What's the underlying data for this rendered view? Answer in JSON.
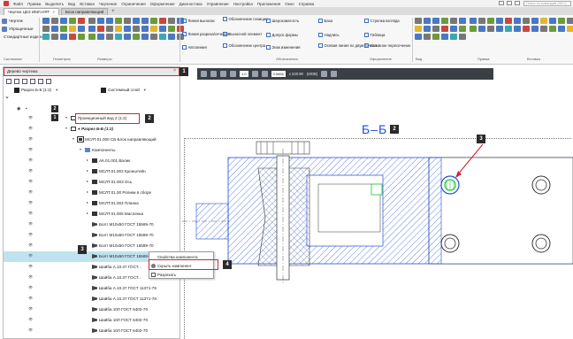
{
  "menu": [
    "Файл",
    "Правка",
    "Выделить",
    "Вид",
    "Вставка",
    "Черчение",
    "Ограничения",
    "Оформление",
    "Диагностика",
    "Управление",
    "Настройка",
    "Приложения",
    "Окно",
    "Справка"
  ],
  "search_placeholder": "Поиск по командам (Alt+/)",
  "tabs": [
    {
      "label": "Чертеж ЦЕЗ ИМЛ.НЯТ",
      "active": true
    },
    {
      "label": "Блок направляющий",
      "active": false
    }
  ],
  "ribbon": {
    "left_items": [
      "Чертеж",
      "Упрощенные",
      "Стандартные изделия"
    ],
    "commands": [
      "Линия выноски",
      "Обозначение позиции",
      "Шероховатость",
      "База",
      "Стрелка взгляда",
      "Линия разреза/сечения",
      "Выносной элемент",
      "Допуск формы",
      "Надпись",
      "Таблица",
      "Автолиния",
      "Обозначение центра",
      "Знак изменения",
      "Осевая линия по двум точкам",
      "Условное пересечение"
    ],
    "groups": [
      "Системная",
      "Геометрия",
      "Размеры",
      "Обозначения",
      "Оформление",
      "Вид",
      "Правка",
      "Вставка"
    ]
  },
  "drawing_toolbar": {
    "step_value": "1.0",
    "zoom_value": "0.9666",
    "coords": "х 220.90",
    "fragment_value": "(МОВ)"
  },
  "panel": {
    "title": "Дерево чертежа",
    "view_selector": "Разрез Б-Б (1:2)",
    "layer_selector": "Системный слой",
    "filter_icon": "filter-icon"
  },
  "tree": {
    "rows": [
      {
        "label": "Проекционный вид 2 (1:2)",
        "type": "view"
      },
      {
        "label": "● Разрез Б-Б (1:2)",
        "type": "view"
      },
      {
        "label": "МСЛТ.01.000 СБ Блок направляющий",
        "type": "asm"
      },
      {
        "label": "Компоненты",
        "type": "folder"
      },
      {
        "label": "АК.01.001 Валик",
        "type": "part"
      },
      {
        "label": "МСЛТ.01.002 Кронштейн",
        "type": "part"
      },
      {
        "label": "МСЛТ.01.003 Ось",
        "type": "part"
      },
      {
        "label": "МСЛТ.01.00 Ролики в сборе",
        "type": "part"
      },
      {
        "label": "МСЛТ.01.004 Планка",
        "type": "part"
      },
      {
        "label": "МСЛТ.01.005 Масленка",
        "type": "part"
      },
      {
        "label": "Болт М10х50 ГОСТ 15589-70",
        "type": "bolt"
      },
      {
        "label": "Болт М10х50 ГОСТ 15589-70",
        "type": "bolt"
      },
      {
        "label": "Болт М10х50 ГОСТ 15589-70",
        "type": "bolt"
      },
      {
        "label": "Болт М10х50 ГОСТ 15589-70",
        "type": "bolt"
      },
      {
        "label": "Шайба А.10.37 ГОСТ...",
        "type": "bolt"
      },
      {
        "label": "Шайба А.10.37 ГОСТ...",
        "type": "bolt"
      },
      {
        "label": "Шайба А.10.37 ГОСТ 11371-78",
        "type": "bolt"
      },
      {
        "label": "Шайба А.10.37 ГОСТ 11371-78",
        "type": "bolt"
      },
      {
        "label": "Шайба 10Л ГОСТ 6402-70",
        "type": "bolt"
      },
      {
        "label": "Шайба 10Л ГОСТ 6402-70",
        "type": "bolt"
      },
      {
        "label": "Шайба 10Л ГОСТ 6402-70",
        "type": "bolt"
      },
      {
        "label": "Шайба 10Л ГОСТ 6402-70",
        "type": "bolt"
      }
    ]
  },
  "context_menu": {
    "items": [
      "Свойства компонента",
      "Скрыть компонент",
      "Разрезать"
    ]
  },
  "drawing": {
    "view_title": "Б–Б",
    "view_badge": "2"
  },
  "badges": {
    "b1": "1",
    "b2": "2",
    "b3_tree": "3",
    "b3_draw": "3",
    "b4": "4",
    "tree_col1": "1",
    "tree_col2": "2"
  },
  "colors": {
    "highlight": "#d0262f",
    "hatch": "#1f4fd6",
    "selected_row": "#bfe3ee",
    "selected_part": "#2ecc40"
  }
}
